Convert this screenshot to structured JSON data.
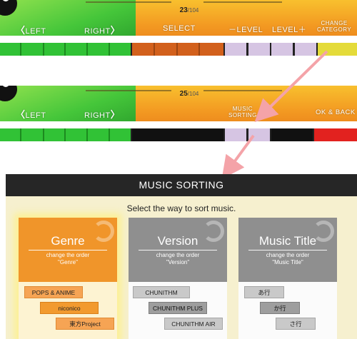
{
  "screen1": {
    "counter_current": "23",
    "counter_total": "/104",
    "left_label": "LEFT",
    "right_label": "RIGHT",
    "select_label": "SELECT",
    "level_down_label": "－LEVEL",
    "level_up_label": "LEVEL＋",
    "change_category_label_line1": "CHANGE",
    "change_category_label_line2": "CATEGORY"
  },
  "screen2": {
    "counter_current": "25",
    "counter_total": "/104",
    "left_label": "LEFT",
    "right_label": "RIGHT",
    "music_sorting_label_line1": "MUSIC",
    "music_sorting_label_line2": "SORTING",
    "ok_back_label": "OK & BACK"
  },
  "sorting": {
    "header": "MUSIC SORTING",
    "subtitle": "Select the way to sort music.",
    "options": [
      {
        "title": "Genre",
        "desc_line1": "change the order",
        "desc_line2": "\"Genre\"",
        "tags": [
          "POPS & ANIME",
          "niconico",
          "東方Project"
        ]
      },
      {
        "title": "Version",
        "desc_line1": "change the order",
        "desc_line2": "\"Version\"",
        "tags": [
          "CHUNITHM",
          "CHUNITHM PLUS",
          "CHUNITHM AIR"
        ]
      },
      {
        "title": "Music Title",
        "desc_line1": "change the order",
        "desc_line2": "\"Music Title\"",
        "tags": [
          "あ行",
          "か行",
          "さ行"
        ]
      }
    ]
  },
  "colors": {
    "genre_accent": "#f0952a",
    "inactive_gray": "#8f8f8f",
    "arrow_pink": "#f4a3a8",
    "header_bg": "#262626",
    "body_bg": "#f6f0cf"
  }
}
